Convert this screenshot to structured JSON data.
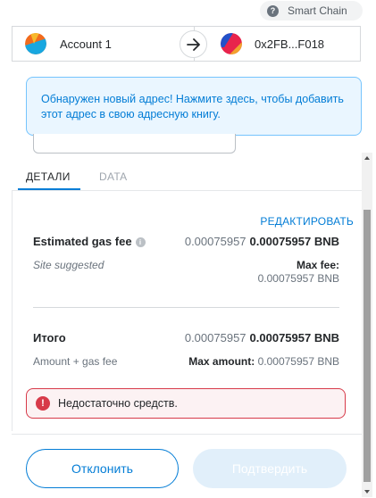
{
  "network": {
    "label": "Smart Chain",
    "icon": "question-icon",
    "icon_glyph": "?"
  },
  "sender": {
    "name": "Account 1"
  },
  "recipient": {
    "address": "0x2FB...F018"
  },
  "notice": {
    "text": "Обнаружен новый адрес! Нажмите здесь, чтобы добавить этот адрес в свою адресную книгу."
  },
  "tabs": [
    {
      "label": "ДЕТАЛИ",
      "active": true
    },
    {
      "label": "DATA",
      "active": false
    }
  ],
  "details": {
    "edit_label": "РЕДАКТИРОВАТЬ",
    "gas": {
      "title": "Estimated gas fee",
      "secondary": "0.00075957",
      "primary": "0.00075957 BNB",
      "note": "Site suggested",
      "max_label": "Max fee:",
      "max_value": "0.00075957 BNB"
    },
    "total": {
      "title": "Итого",
      "secondary": "0.00075957",
      "primary": "0.00075957 BNB",
      "note": "Amount + gas fee",
      "max_label": "Max amount:",
      "max_value": "0.00075957 BNB"
    }
  },
  "error": {
    "text": "Недостаточно средств.",
    "icon_glyph": "!"
  },
  "actions": {
    "reject": "Отклонить",
    "confirm": "Подтвердить"
  },
  "colors": {
    "accent": "#037dd6",
    "error": "#d73a49",
    "notice_bg": "#eaf6ff"
  }
}
